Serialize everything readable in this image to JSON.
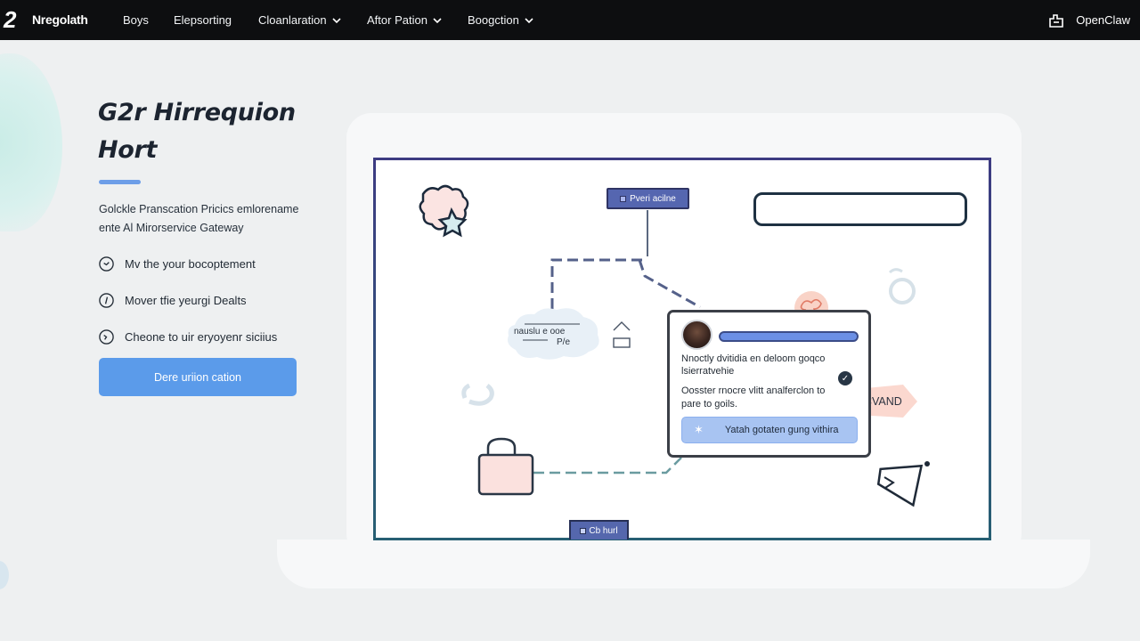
{
  "nav": {
    "brand": "Nregolath",
    "items": [
      {
        "label": "Boys",
        "has_dropdown": false
      },
      {
        "label": "Elepsorting",
        "has_dropdown": false
      },
      {
        "label": "Cloanlaration",
        "has_dropdown": true
      },
      {
        "label": "Aftor Pation",
        "has_dropdown": true
      },
      {
        "label": "Boogction",
        "has_dropdown": true
      }
    ],
    "right_brand": "OpenClaw"
  },
  "hero": {
    "title_line1": "G2r Hirrequion",
    "title_line2": "Hort",
    "description": "Golckle Pranscation Pricics emlorename ente Al Mirorservice Gateway",
    "features": [
      {
        "icon": "clock-icon",
        "label": "Mv the your bocoptement"
      },
      {
        "icon": "info-circle-icon",
        "label": "Mover tfie yeurgi Dealts"
      },
      {
        "icon": "refresh-icon",
        "label": "Cheone to uir eryoyenr siciius"
      }
    ],
    "cta_label": "Dere uriion cation"
  },
  "diagram": {
    "node_label": "Pveri acilne",
    "cloud_text_1": "nauslu e ooe",
    "cloud_text_2": "P/e",
    "bottom_tab_label": "Cb hurl",
    "badge_label": "CVAND",
    "card": {
      "text1": "Nnoctly dvitidia en deloom goqco lsierratvehie",
      "text2": "Oosster rnocre vlitt analferclon to pare to goils.",
      "button_label": "Yatah gotaten gung vithira"
    }
  },
  "colors": {
    "nav_bg": "#0d0e10",
    "accent_blue": "#5b9bea",
    "screen_border": "#3a3f7a",
    "card_button": "#a8c4f2"
  }
}
